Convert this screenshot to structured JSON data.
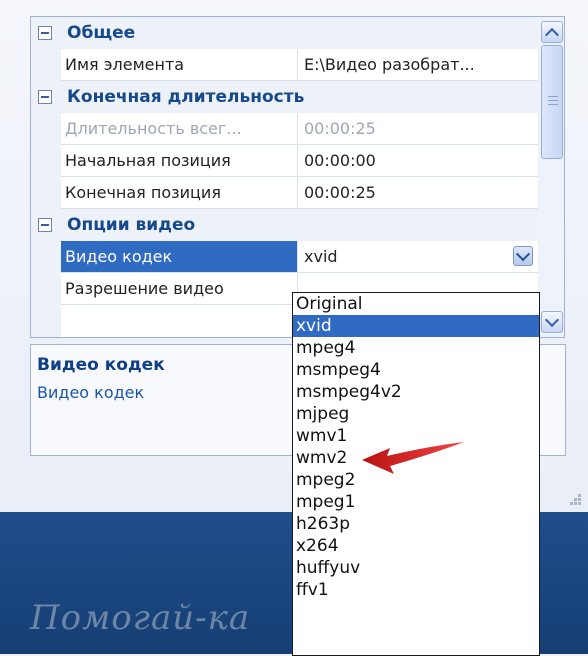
{
  "categories": {
    "general": "Общее",
    "end_duration": "Конечная длительность",
    "video_options": "Опции видео"
  },
  "properties": {
    "element_name": {
      "name": "Имя элемента",
      "value": "E:\\Видео разобрат..."
    },
    "total_duration": {
      "name": "Длительность всег...",
      "value": "00:00:25"
    },
    "start_position": {
      "name": "Начальная позиция",
      "value": "00:00:00"
    },
    "end_position": {
      "name": "Конечная позиция",
      "value": "00:00:25"
    },
    "video_codec": {
      "name": "Видео кодек",
      "value": "xvid"
    },
    "video_resolution": {
      "name": "Разрешение видео",
      "value": ""
    }
  },
  "description": {
    "title": "Видео кодек",
    "text": "Видео кодек"
  },
  "dropdown_options": [
    "Original",
    "xvid",
    "mpeg4",
    "msmpeg4",
    "msmpeg4v2",
    "mjpeg",
    "wmv1",
    "wmv2",
    "mpeg2",
    "mpeg1",
    "h263p",
    "x264",
    "huffyuv",
    "ffv1"
  ],
  "dropdown_selected": "xvid",
  "watermark": "Помогай-ка",
  "colors": {
    "selection": "#2f6bc2",
    "category_text": "#16498c",
    "arrow": "#e02020",
    "banner": "#1f4e8c"
  },
  "icons": {
    "collapse": "minus-box-icon",
    "scroll_up": "chevron-up-icon",
    "scroll_down": "chevron-down-icon",
    "combo": "chevron-down-icon",
    "annotation": "red-arrow-icon"
  }
}
